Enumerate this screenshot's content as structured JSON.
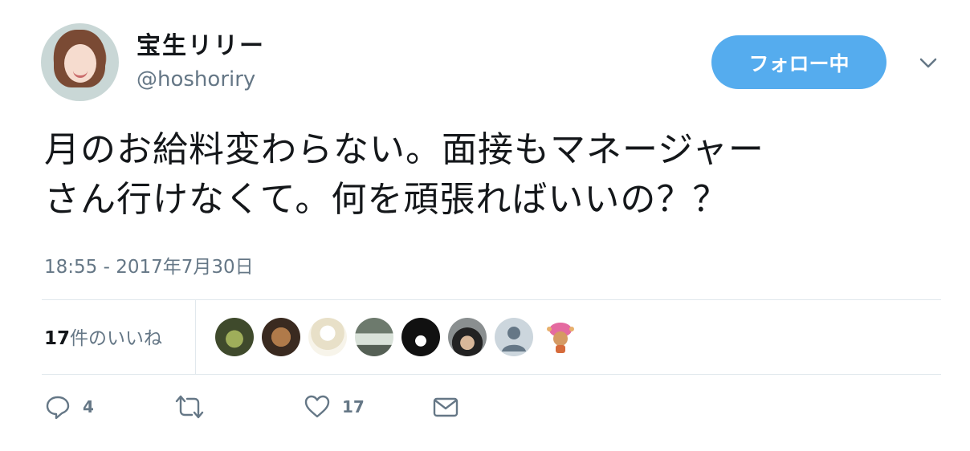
{
  "user": {
    "display_name": "宝生リリー",
    "handle": "@hoshoriry"
  },
  "follow_button": {
    "label": "フォロー中"
  },
  "tweet": {
    "line1": "月のお給料変わらない。面接もマネージャー",
    "line2": "さん行けなくて。何を頑張ればいいの？？"
  },
  "timestamp": "18:55 - 2017年7月30日",
  "likes": {
    "count": "17",
    "label": "件のいいね"
  },
  "actions": {
    "reply_count": "4",
    "like_count": "17"
  },
  "colors": {
    "accent": "#55acee",
    "muted": "#657786",
    "divider": "#e1e8ed"
  }
}
